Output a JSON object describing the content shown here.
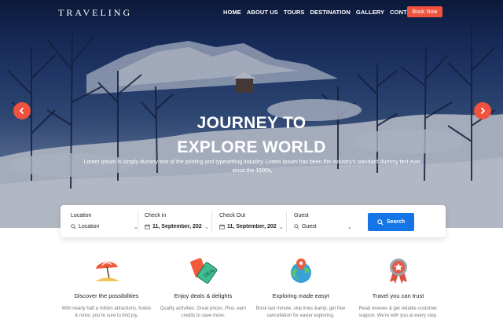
{
  "nav": {
    "logo": "TRAVELING",
    "items": [
      "HOME",
      "ABOUT US",
      "TOURS",
      "DESTINATION",
      "GALLERY",
      "CONTACT"
    ],
    "cta": "Book Now"
  },
  "hero": {
    "title_line1": "JOURNEY TO",
    "title_line2": "EXPLORE WORLD",
    "text": "Lorem Ipsum is simply dummy text of the printing and typesetting industry. Lorem Ipsum has been the industry's standard dummy text ever since the 1500s,"
  },
  "search": {
    "location_label": "Location",
    "location_value": "Location",
    "checkin_label": "Check in",
    "checkin_value": "11, September, 202",
    "checkout_label": "Check Out",
    "checkout_value": "11, September, 202",
    "guest_label": "Guest",
    "guest_value": "Guest",
    "button": "Search"
  },
  "features": [
    {
      "icon": "beach-umbrella-icon",
      "title": "Discover the possibilities",
      "desc": "With nearly half a million attractions, hotels & more, you're sure to find joy."
    },
    {
      "icon": "price-tags-icon",
      "title": "Enjoy deals & delights",
      "desc": "Quality activities. Great prices. Plus, earn credits to save more."
    },
    {
      "icon": "globe-pin-icon",
      "title": "Exploring made easyt",
      "desc": "Book last minute, skip lines &amp; get free cancellation for easier exploring."
    },
    {
      "icon": "award-ribbon-icon",
      "title": "Travel you can trust",
      "desc": "Read reviews & get reliable customer support. We're with you at every step."
    }
  ],
  "colors": {
    "accent": "#f1523e",
    "button": "#1574e6"
  }
}
